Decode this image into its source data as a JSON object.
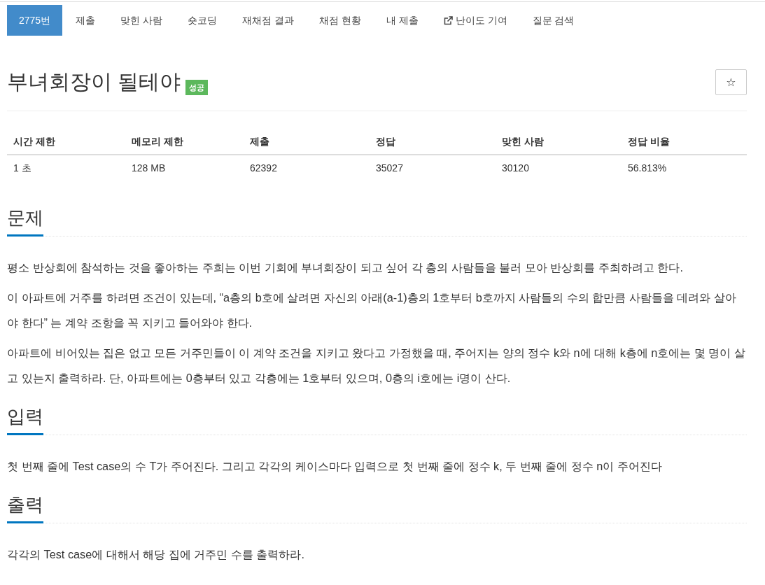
{
  "tabs": [
    {
      "label": "2775번",
      "kind": "internal",
      "selected": true
    },
    {
      "label": "제출",
      "kind": "internal",
      "selected": false
    },
    {
      "label": "맞힌 사람",
      "kind": "internal",
      "selected": false
    },
    {
      "label": "숏코딩",
      "kind": "internal",
      "selected": false
    },
    {
      "label": "재채점 결과",
      "kind": "internal",
      "selected": false
    },
    {
      "label": "채점 현황",
      "kind": "internal",
      "selected": false
    },
    {
      "label": "내 제출",
      "kind": "internal",
      "selected": false
    },
    {
      "label": "난이도 기여",
      "kind": "external",
      "selected": false
    },
    {
      "label": "질문 검색",
      "kind": "internal",
      "selected": false
    }
  ],
  "problem": {
    "title": "부녀회장이 될테야",
    "badge": "성공",
    "star_button": "☆"
  },
  "limits_table": {
    "columns": [
      "시간 제한",
      "메모리 제한",
      "제출",
      "정답",
      "맞힌 사람",
      "정답 비율"
    ],
    "rows": [
      [
        "1 초",
        "128 MB",
        "62392",
        "35027",
        "30120",
        "56.813%"
      ]
    ]
  },
  "sections": [
    {
      "heading": "문제",
      "paragraphs": [
        "평소 반상회에 참석하는 것을 좋아하는 주희는 이번 기회에 부녀회장이 되고 싶어 각 층의 사람들을 불러 모아 반상회를 주최하려고 한다.",
        "이 아파트에 거주를 하려면 조건이 있는데, “a층의 b호에 살려면 자신의 아래(a-1)층의 1호부터 b호까지 사람들의 수의 합만큼 사람들을 데려와 살아야 한다” 는 계약 조항을 꼭 지키고 들어와야 한다.",
        "아파트에 비어있는 집은 없고 모든 거주민들이 이 계약 조건을 지키고 왔다고 가정했을 때, 주어지는 양의 정수 k와 n에 대해 k층에 n호에는 몇 명이 살고 있는지 출력하라. 단, 아파트에는 0층부터 있고 각층에는 1호부터 있으며, 0층의 i호에는 i명이 산다."
      ]
    },
    {
      "heading": "입력",
      "paragraphs": [
        "첫 번째 줄에 Test case의 수 T가 주어진다. 그리고 각각의 케이스마다 입력으로 첫 번째 줄에 정수 k, 두 번째 줄에 정수 n이 주어진다"
      ]
    },
    {
      "heading": "출력",
      "paragraphs": [
        "각각의 Test case에 대해서 해당 집에 거주민 수를 출력하라."
      ]
    }
  ]
}
